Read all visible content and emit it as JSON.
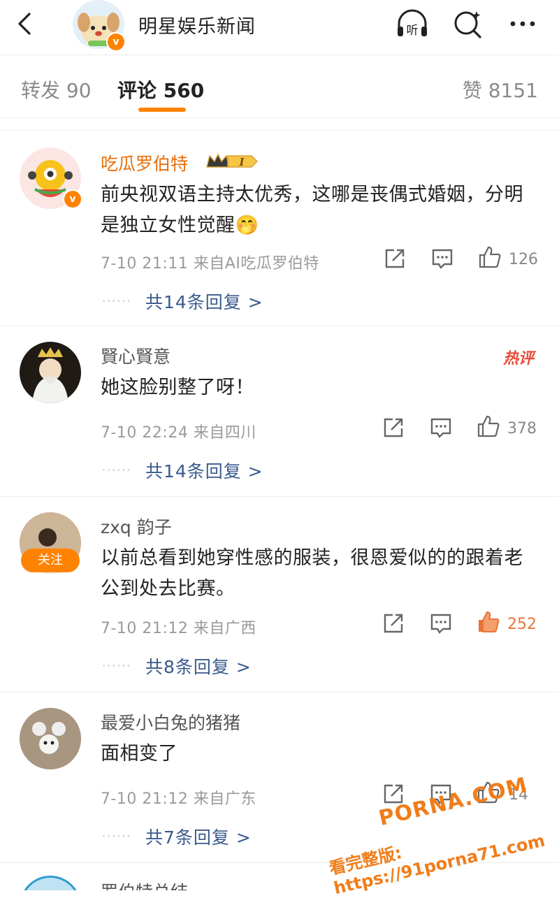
{
  "header": {
    "title": "明星娱乐新闻",
    "listen_label": "听",
    "icons": [
      "back-icon",
      "listen-icon",
      "search-icon",
      "more-icon"
    ]
  },
  "tabs": {
    "repost": "转发 90",
    "comments": "评论 560",
    "likes": "赞 8151"
  },
  "colors": {
    "accent": "#ff8200",
    "link": "#3a5a8c",
    "hot": "#e74b3b",
    "liked": "#e8743a"
  },
  "comments": [
    {
      "username": "吃瓜罗伯特",
      "badge": "I",
      "text": "前央视双语主持太优秀，这哪是丧偶式婚姻，分明是独立女性觉醒",
      "emoji": "🤭",
      "meta": "7-10 21:11 来自AI吃瓜罗伯特",
      "likes": "126",
      "replies": "共14条回复 >"
    },
    {
      "username": "賢心賢意",
      "hot_tag": "热评",
      "text": "她这脸别整了呀！",
      "meta": "7-10 22:24 来自四川",
      "likes": "378",
      "replies": "共14条回复 >"
    },
    {
      "username": "zxq 韵子",
      "follow_label": "关注",
      "text": "以前总看到她穿性感的服装，很恩爱似的的跟着老公到处去比赛。",
      "meta": "7-10 21:12 来自广西",
      "likes": "252",
      "replies": "共8条回复 >"
    },
    {
      "username": "最爱小白兔的猪猪",
      "text": "面相变了",
      "meta": "7-10 21:12 来自广东",
      "likes": "14",
      "replies": "共7条回复 >"
    },
    {
      "username": "罗伯特总结"
    }
  ],
  "watermark": {
    "line1": "PORNA.COM",
    "line2": "看完整版: https://91porna71.com"
  }
}
